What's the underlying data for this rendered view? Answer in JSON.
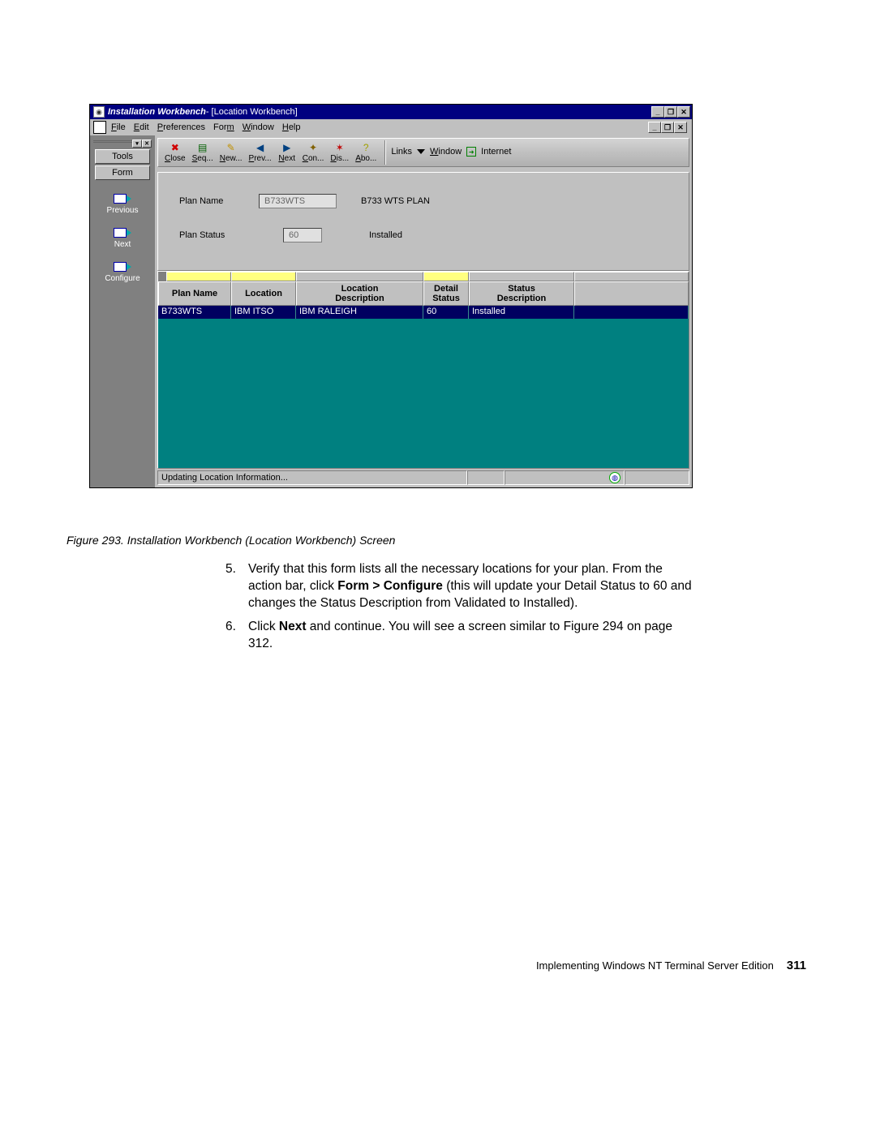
{
  "title": {
    "app_name": "Installation Workbench",
    "subtitle": " - [Location Workbench]"
  },
  "menu": {
    "file": "File",
    "edit": "Edit",
    "preferences": "Preferences",
    "form": "Form",
    "window": "Window",
    "help": "Help"
  },
  "sidebar": {
    "tools_label": "Tools",
    "form_label": "Form",
    "actions": [
      {
        "label": "Previous"
      },
      {
        "label": "Next"
      },
      {
        "label": "Configure"
      }
    ]
  },
  "toolbar": {
    "buttons": [
      {
        "label": "Close",
        "color": "#d00000",
        "glyph": "✖"
      },
      {
        "label": "Seq...",
        "color": "#006000",
        "glyph": "▤"
      },
      {
        "label": "New...",
        "color": "#c09000",
        "glyph": "✎"
      },
      {
        "label": "Prev...",
        "color": "#004080",
        "glyph": "◀"
      },
      {
        "label": "Next",
        "color": "#004080",
        "glyph": "▶"
      },
      {
        "label": "Con...",
        "color": "#806000",
        "glyph": "✦"
      },
      {
        "label": "Dis...",
        "color": "#c00000",
        "glyph": "✶"
      },
      {
        "label": "Abo...",
        "color": "#a0a000",
        "glyph": "?"
      }
    ],
    "links_label": "Links",
    "window_link": "Window",
    "internet_link": "Internet"
  },
  "form": {
    "plan_name_label": "Plan Name",
    "plan_name_value": "B733WTS",
    "plan_name_display": "B733 WTS PLAN",
    "plan_status_label": "Plan Status",
    "plan_status_value": "60",
    "plan_status_display": "Installed"
  },
  "grid": {
    "headers": [
      "Plan Name",
      "Location",
      "Location\nDescription",
      "Detail\nStatus",
      "Status\nDescription"
    ],
    "rows": [
      [
        "B733WTS",
        "IBM ITSO",
        "IBM RALEIGH",
        "60",
        "Installed"
      ]
    ]
  },
  "status": {
    "text": "Updating Location Information..."
  },
  "caption": "Figure 293.  Installation Workbench (Location Workbench) Screen",
  "instructions": [
    {
      "num": "5.",
      "segments": [
        {
          "t": "Verify that this form lists all the necessary locations for your plan. From the action bar, click "
        },
        {
          "t": "Form > Configure",
          "b": true
        },
        {
          "t": " (this will update your Detail Status to 60 and changes the Status Description from Validated to Installed)."
        }
      ]
    },
    {
      "num": "6.",
      "segments": [
        {
          "t": "Click "
        },
        {
          "t": "Next",
          "b": true
        },
        {
          "t": " and continue. You will see a screen similar to Figure 294 on page 312."
        }
      ]
    }
  ],
  "footer": {
    "text": "Implementing Windows NT Terminal Server Edition",
    "page": "311"
  }
}
